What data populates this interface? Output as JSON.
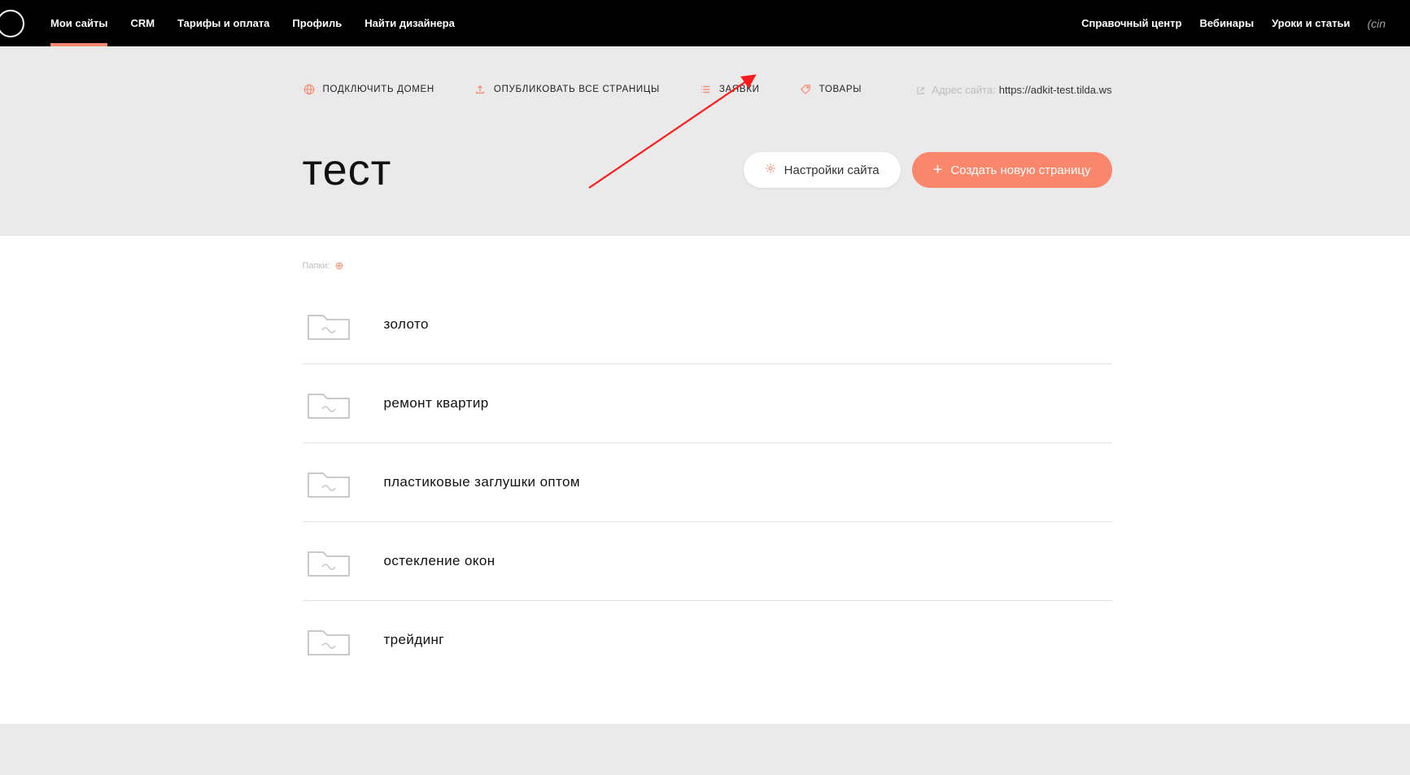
{
  "topnav": {
    "left": [
      {
        "label": "Мои сайты",
        "active": true
      },
      {
        "label": "CRM",
        "active": false
      },
      {
        "label": "Тарифы и оплата",
        "active": false
      },
      {
        "label": "Профиль",
        "active": false
      },
      {
        "label": "Найти дизайнера",
        "active": false
      }
    ],
    "right": [
      {
        "label": "Справочный центр"
      },
      {
        "label": "Вебинары"
      },
      {
        "label": "Уроки и статьи"
      }
    ],
    "tail": "(cin"
  },
  "actions": {
    "connect_domain": "ПОДКЛЮЧИТЬ ДОМЕН",
    "publish_all": "ОПУБЛИКОВАТЬ ВСЕ СТРАНИЦЫ",
    "requests": "ЗАЯВКИ",
    "products": "ТОВАРЫ"
  },
  "address": {
    "prefix": "Адрес сайта:",
    "value": "https://adkit-test.tilda.ws"
  },
  "project": {
    "title": "тест"
  },
  "buttons": {
    "site_settings": "Настройки сайта",
    "new_page": "Создать новую страницу"
  },
  "folders": {
    "label": "Папки:",
    "items": [
      {
        "name": "золото"
      },
      {
        "name": "ремонт квартир"
      },
      {
        "name": "пластиковые заглушки оптом"
      },
      {
        "name": "остекление окон"
      },
      {
        "name": "трейдинг"
      }
    ]
  }
}
